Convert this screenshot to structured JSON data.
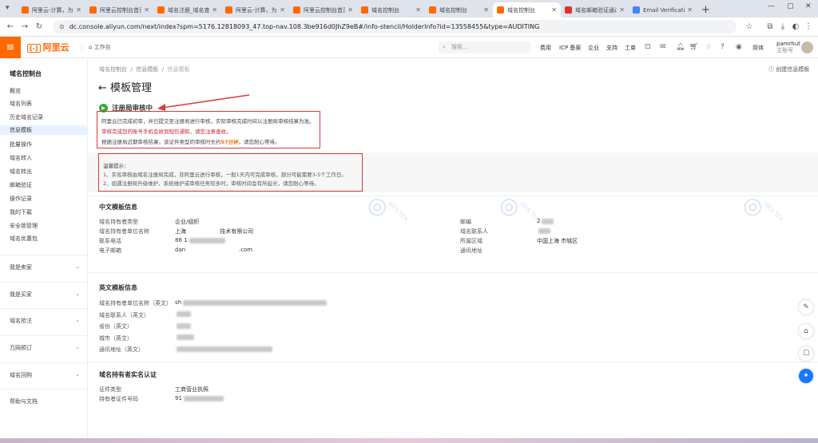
{
  "tabs": [
    {
      "title": "阿里云-计算，为了",
      "icon": "aliyun-icon",
      "active": false
    },
    {
      "title": "阿里云控制台首页",
      "icon": "aliyun-icon",
      "active": false
    },
    {
      "title": "域名注册_域名查询",
      "icon": "aliyun-icon",
      "active": false
    },
    {
      "title": "阿里云-计算，为了",
      "icon": "aliyun-icon",
      "active": false
    },
    {
      "title": "阿里云控制台首页",
      "icon": "aliyun-icon",
      "active": false
    },
    {
      "title": "域名控制台",
      "icon": "aliyun-icon",
      "active": false
    },
    {
      "title": "域名控制台",
      "icon": "aliyun-icon",
      "active": false
    },
    {
      "title": "域名控制台",
      "icon": "aliyun-icon",
      "active": true
    },
    {
      "title": "域名邮箱验证通过",
      "icon": "gmail-icon",
      "active": false
    },
    {
      "title": "Email Verification",
      "icon": "email-icon",
      "active": false
    }
  ],
  "new_tab": "+",
  "url": "dc.console.aliyun.com/next/index?spm=5176.12818093_47.top-nav.108.3be916d0JhZ9eB#/info-stencil/HolderInfo?id=13558455&type=AUDITING",
  "topnav": {
    "logo": "阿里云",
    "workbench": "工作台",
    "search_placeholder": "搜索...",
    "links": [
      "费用",
      "ICP 备案",
      "企业",
      "支持",
      "工单"
    ],
    "lang": "简体",
    "user_name": "pamrhut",
    "user_role": "主账号"
  },
  "sidebar": {
    "title": "域名控制台",
    "items": [
      "概览",
      "域名列表",
      "历史域名记录",
      "信息模板",
      "批量操作",
      "域名转入",
      "域名转出",
      "邮箱验证",
      "操作记录",
      "我的下载",
      "安全锁管理",
      "域名优惠包"
    ],
    "active_index": 3,
    "groups": [
      "我是卖家",
      "我是买家",
      "域名抢注",
      "万网预订",
      "域名回购",
      "帮助与文档"
    ]
  },
  "breadcrumb": [
    "域名控制台",
    "信息模板",
    "信息模板"
  ],
  "page_title": "模板管理",
  "create_link": "创建信息模板",
  "status_title": "注册局审核中",
  "status_lines": {
    "l1": "阿里云已完成初审，并已提交至注册局进行审核，实际审核完成时间以注册局审核结果为准。",
    "l2": "审核完成您的账号手机会收到短信通知，请您注意查收。",
    "l3_pre": "根据注册局近期审核结果，该证件类型的审核时长约",
    "l3_hl": "57分钟",
    "l3_post": "，请您耐心等待。"
  },
  "tips": {
    "title": "温馨提示：",
    "t1": "1、实名审核由域名注册局完成，非阿里云进行审核，一般1天内可完成审核，部分可能需要3-5个工作日。",
    "t2": "2、如遇注册局升级维护、系统维护或审核任务较多时，审核时间会有所延长，请您耐心等待。"
  },
  "cn_info": {
    "title": "中文模板信息",
    "left": [
      {
        "label": "域名持有者类型",
        "value": "企业/组织"
      },
      {
        "label": "域名持有者单位名称",
        "value": "上海                   技术有限公司"
      },
      {
        "label": "联系电话",
        "value": "86 1"
      },
      {
        "label": "电子邮箱",
        "value": "dan                              .com"
      }
    ],
    "right": [
      {
        "label": "邮编",
        "value": "2"
      },
      {
        "label": "域名联系人",
        "value": ""
      },
      {
        "label": "所属区域",
        "value": "中国上海 市辖区"
      },
      {
        "label": "通讯地址",
        "value": ""
      }
    ]
  },
  "en_info": {
    "title": "英文模板信息",
    "rows": [
      {
        "label": "域名持有者单位名称（英文）",
        "value": "sh"
      },
      {
        "label": "域名联系人（英文）",
        "value": ""
      },
      {
        "label": "省份（英文）",
        "value": ""
      },
      {
        "label": "城市（英文）",
        "value": ""
      },
      {
        "label": "通讯地址（英文）",
        "value": ""
      }
    ]
  },
  "real_name": {
    "title": "域名持有者实名认证",
    "rows": [
      {
        "label": "证件类型",
        "value": "工商营业执照"
      },
      {
        "label": "持有者证件号码",
        "value": "91"
      }
    ]
  },
  "watermark": "WEB TEK",
  "colors": {
    "brand": "#ff6a00",
    "annotation_red": "#d83a3a",
    "status_green": "#2bae3a",
    "highlight_orange": "#ff6a00"
  }
}
